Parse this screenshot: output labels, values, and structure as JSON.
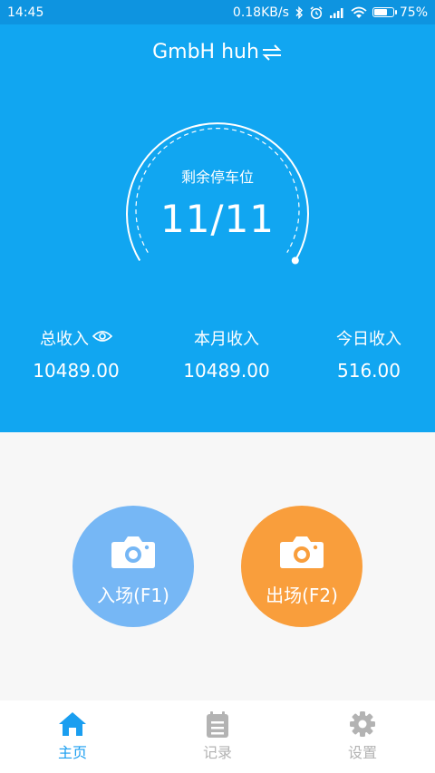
{
  "status_bar": {
    "time": "14:45",
    "network_speed": "0.18KB/s",
    "battery_percent": "75%",
    "battery_level": 0.75,
    "icons": [
      "bluetooth-icon",
      "alarm-icon",
      "signal-icon",
      "wifi-icon",
      "battery-icon"
    ]
  },
  "header": {
    "title": "GmbH huh",
    "switch_icon": "swap-arrows-icon"
  },
  "gauge": {
    "label": "剩余停车位",
    "value": "11/11",
    "fill_fraction": 1.0
  },
  "stats": [
    {
      "label": "总收入",
      "value": "10489.00",
      "icon": "eye-icon"
    },
    {
      "label": "本月收入",
      "value": "10489.00"
    },
    {
      "label": "今日收入",
      "value": "516.00"
    }
  ],
  "actions": {
    "enter": {
      "label": "入场(F1)",
      "icon": "camera-icon",
      "color": "#76b7f5"
    },
    "exit": {
      "label": "出场(F2)",
      "icon": "camera-icon",
      "color": "#f99e3c"
    }
  },
  "tabs": [
    {
      "label": "主页",
      "icon": "home-icon",
      "active": true
    },
    {
      "label": "记录",
      "icon": "records-icon",
      "active": false
    },
    {
      "label": "设置",
      "icon": "gear-icon",
      "active": false
    }
  ],
  "colors": {
    "status_bar": "#0e94e0",
    "hero": "#11a6f1",
    "tab_active": "#1a9ef0",
    "tab_inactive": "#b3b3b3"
  }
}
